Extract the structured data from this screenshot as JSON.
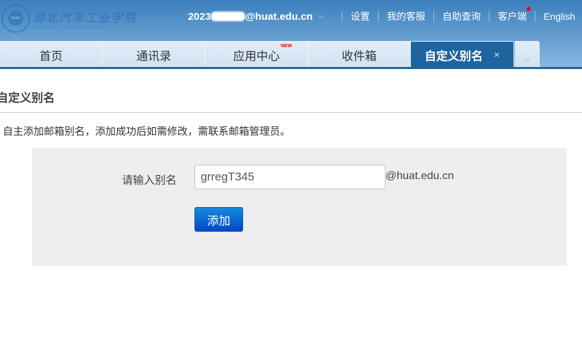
{
  "logo": {
    "cn": "湖北汽车工业学院",
    "en": "HUBEI UNIVERSITY OF AUTOMOTIVE TECHNOLOGY",
    "seal": "HUAT"
  },
  "header": {
    "email_prefix": "2023",
    "email_suffix": "@huat.edu.cn",
    "links": [
      "设置",
      "我的客服",
      "自助查询",
      "客户端",
      "English"
    ]
  },
  "tabs": [
    {
      "label": "首页"
    },
    {
      "label": "通讯录"
    },
    {
      "label": "应用中心",
      "badge": "NEW"
    },
    {
      "label": "收件箱"
    },
    {
      "label": "自定义别名",
      "active": true,
      "close": "×"
    }
  ],
  "page": {
    "title": "自定义别名",
    "description": "自主添加邮箱别名，添加成功后如需修改，需联系邮箱管理员。",
    "form": {
      "label": "请输入别名",
      "value": "grregT345",
      "suffix": "@huat.edu.cn",
      "button": "添加"
    }
  },
  "colors": {
    "accent": "#1e65a0",
    "button": "#0a5fd0",
    "notification_dot": "#ff0000"
  }
}
